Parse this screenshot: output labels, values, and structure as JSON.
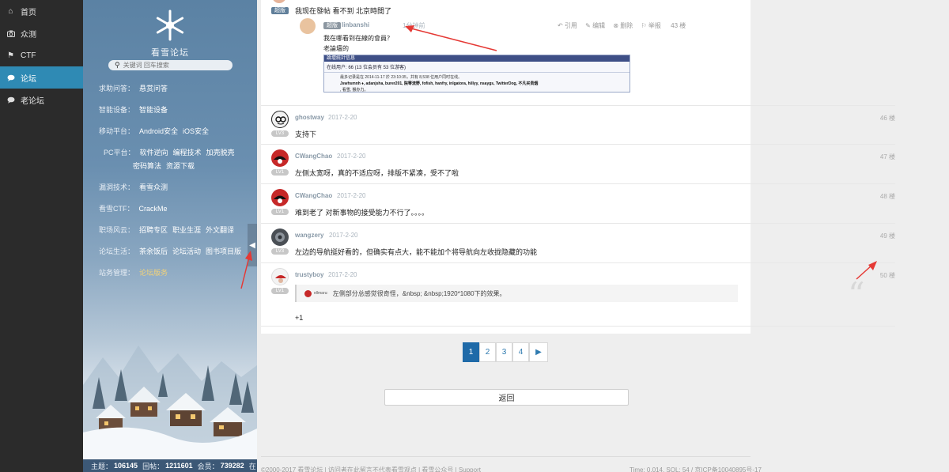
{
  "nav": {
    "items": [
      {
        "icon": "home-icon",
        "label": "首页",
        "active": false
      },
      {
        "icon": "camera-icon",
        "label": "众测",
        "active": false
      },
      {
        "icon": "flag-icon",
        "label": "CTF",
        "active": false
      },
      {
        "icon": "chat-bubble-icon",
        "label": "论坛",
        "active": true
      },
      {
        "icon": "chat-bubble-icon",
        "label": "老论坛",
        "active": false
      }
    ]
  },
  "forum": {
    "title": "看雪论坛",
    "search_placeholder": "关键词 回车搜索",
    "categories": [
      {
        "label": "求助问答：",
        "links": [
          "悬赏问答"
        ]
      },
      {
        "label": "智能设备：",
        "links": [
          "智能设备"
        ]
      },
      {
        "label": "移动平台：",
        "links": [
          "Android安全",
          "iOS安全"
        ]
      },
      {
        "label": "PC平台：",
        "links": [
          "软件逆向",
          "编程技术",
          "加壳脱壳"
        ]
      },
      {
        "label": "",
        "links": [
          "密码算法",
          "资源下载"
        ]
      },
      {
        "label": "漏洞技术：",
        "links": [
          "看雪众测"
        ]
      },
      {
        "label": "看雪CTF：",
        "links": [
          "CrackMe"
        ]
      },
      {
        "label": "职场风云：",
        "links": [
          "招聘专区",
          "职业生涯",
          "外文翻译"
        ]
      },
      {
        "label": "论坛生活：",
        "links": [
          "茶余饭后",
          "论坛活动",
          "图书项目版"
        ]
      },
      {
        "label": "站务管理：",
        "links": [
          "论坛版务"
        ]
      }
    ],
    "stats": {
      "topics_label": "主题：",
      "topics": "106145",
      "replies_label": "回帖：",
      "replies": "1211601",
      "members_label": "会员：",
      "members": "739282",
      "tail": "在"
    }
  },
  "top_post": {
    "badge": "超版",
    "text": "我现在發帖 看不到 北京時間了",
    "quote": {
      "badge": "超版",
      "user": "linbanshi",
      "time": "1分钟前",
      "actions": [
        "引用",
        "编辑",
        "删除",
        "举报"
      ],
      "floor": "43 楼",
      "line1": "我在哪看到在線的會員？",
      "line2": "老論壇的",
      "screenshot": {
        "title": "論壇統計信息",
        "line1": "在线用户: 66 (13 位会员有 53 位游客)",
        "line2": "最多记录是在 2014-11-17 於 23:10:35，共有 8,538 位用户同时在线。",
        "line3": "Jswhsmnh ♦, adanjsha, burer201, 院零流野, fofish, hanfry, inlgatora, hillyy, nsaygs, TwitterDog, 不凡买贵烟",
        "line4": ", 看雪, 猴办力。"
      }
    }
  },
  "replies": [
    {
      "user": "ghostway",
      "date": "2017-2-20",
      "floor": "46 楼",
      "text": "支持下",
      "level": "LV3"
    },
    {
      "user": "CWangChao",
      "date": "2017-2-20",
      "floor": "47 楼",
      "text": "左侧太宽呀，真的不适应呀，排版不紧凑，受不了啦",
      "level": "LV1"
    },
    {
      "user": "CWangChao",
      "date": "2017-2-20",
      "floor": "48 楼",
      "text": "难到老了  对新事物的接受能力不行了。。。。",
      "level": "LV1"
    },
    {
      "user": "wangzery",
      "date": "2017-2-20",
      "floor": "49 楼",
      "text": "左边的导航挺好看的，但确实有点大，能不能加个将导航向左收拢隐藏的功能",
      "level": "LV3"
    },
    {
      "user": "trustyboy",
      "date": "2017-2-20",
      "floor": "50 楼",
      "text": "+1",
      "level": "LV1",
      "quote_user": "ellmaru:",
      "quote_text": "左侧部分总感觉很奇怪，&nbsp; &nbsp;1920*1080下的效果。"
    }
  ],
  "pagination": {
    "pages": [
      "1",
      "2",
      "3",
      "4"
    ],
    "current": "1",
    "next": "▶"
  },
  "back_button": "返回",
  "footer": {
    "left": "©2000-2017 看雪论坛 | 访问者在此留言不代表看雪观点 | 看雪公众号 | Support",
    "right": "Time: 0.014, SQL: 54 / 京ICP备10040895号-17"
  },
  "colors": {
    "nav_bg": "#2b2b2b",
    "nav_active": "#2f8ab4",
    "page_link": "#2f7bb0",
    "page_current": "#1f6aa8",
    "annotation_arrow": "#e53935"
  }
}
